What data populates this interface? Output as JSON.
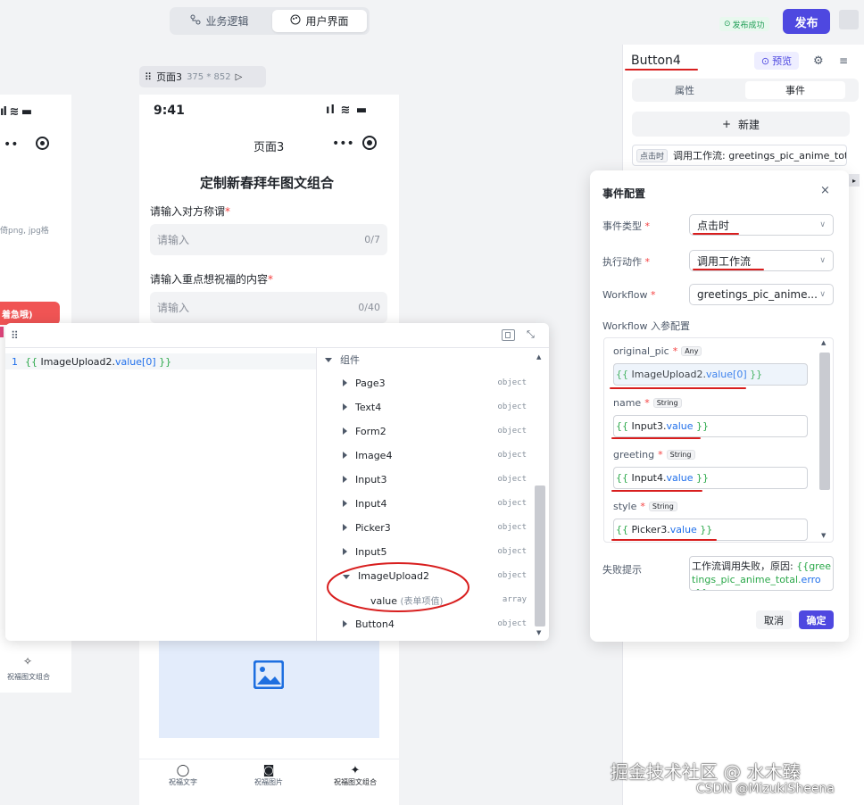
{
  "header": {
    "tabs": [
      {
        "label": "业务逻辑",
        "icon": "flow-icon"
      },
      {
        "label": "用户界面",
        "icon": "palette-icon"
      }
    ],
    "publish_status": "发布成功",
    "publish_label": "发布"
  },
  "canvas": {
    "left_phone": {
      "partial_text": "倚png, jpg格",
      "red_text": "着急哦)",
      "bottom_label": "祝福图文组合"
    },
    "page_label": {
      "name": "页面3",
      "size": "375 * 852"
    },
    "phone": {
      "time": "9:41",
      "nav_title": "页面3",
      "heading": "定制新春拜年图文组合",
      "field1_label": "请输入对方称谓",
      "field1_placeholder": "请输入",
      "field1_count": "0/7",
      "field2_label": "请输入重点想祝福的内容",
      "field2_placeholder": "请输入",
      "field2_count": "0/40",
      "bottom_nav": [
        "祝福文字",
        "祝福图片",
        "祝福图文组合"
      ]
    }
  },
  "editor": {
    "line_no": "1",
    "code_open": "{{ ",
    "code_ident": "ImageUpload2.",
    "code_prop": "value[0]",
    "code_close": " }}",
    "tree_root": "组件",
    "items": [
      {
        "name": "Page3",
        "type": "object"
      },
      {
        "name": "Text4",
        "type": "object"
      },
      {
        "name": "Form2",
        "type": "object"
      },
      {
        "name": "Image4",
        "type": "object"
      },
      {
        "name": "Input3",
        "type": "object"
      },
      {
        "name": "Input4",
        "type": "object"
      },
      {
        "name": "Picker3",
        "type": "object"
      },
      {
        "name": "Input5",
        "type": "object"
      },
      {
        "name": "ImageUpload2",
        "type": "object"
      },
      {
        "name": "value",
        "note": "(表单项值)",
        "type": "array"
      },
      {
        "name": "Button4",
        "type": "object"
      }
    ]
  },
  "right_panel": {
    "component_name": "Button4",
    "preview_label": "预览",
    "tabs": [
      "属性",
      "事件"
    ],
    "new_label": "新建",
    "event_tag": "点击时",
    "event_text": "调用工作流: greetings_pic_anime_total"
  },
  "dialog": {
    "title": "事件配置",
    "event_type_label": "事件类型",
    "event_type_value": "点击时",
    "action_label": "执行动作",
    "action_value": "调用工作流",
    "workflow_label": "Workflow",
    "workflow_value": "greetings_pic_anime...",
    "params_label": "Workflow 入参配置",
    "params": [
      {
        "name": "original_pic",
        "required": true,
        "type": "Any",
        "open": "{{ ",
        "ident": "ImageUpload2.",
        "prop": "value[0]",
        "close": " }}"
      },
      {
        "name": "name",
        "required": true,
        "type": "String",
        "open": "{{ ",
        "ident": "Input3.",
        "prop": "value",
        "close": " }}"
      },
      {
        "name": "greeting",
        "required": true,
        "type": "String",
        "open": "{{ ",
        "ident": "Input4.",
        "prop": "value",
        "close": " }}"
      },
      {
        "name": "style",
        "required": true,
        "type": "String",
        "open": "{{ ",
        "ident": "Picker3.",
        "prop": "value",
        "close": " }}"
      }
    ],
    "fail_label": "失败提示",
    "fail_text_prefix": "工作流调用失败，原因: ",
    "fail_text_expr_open": "{{greetings_pic_anime_total.",
    "fail_text_expr_prop": "error",
    "fail_text_expr_close": "}}",
    "cancel_label": "取消",
    "confirm_label": "确定"
  },
  "watermark": {
    "line1": "掘金技术社区 @ 水木臻",
    "line2": "CSDN @MizukiSheena"
  },
  "colors": {
    "accent": "#4e48e0",
    "annotation": "#d81e1e",
    "success": "#1e9d55",
    "placeholder_image": "#e3ecfb"
  }
}
